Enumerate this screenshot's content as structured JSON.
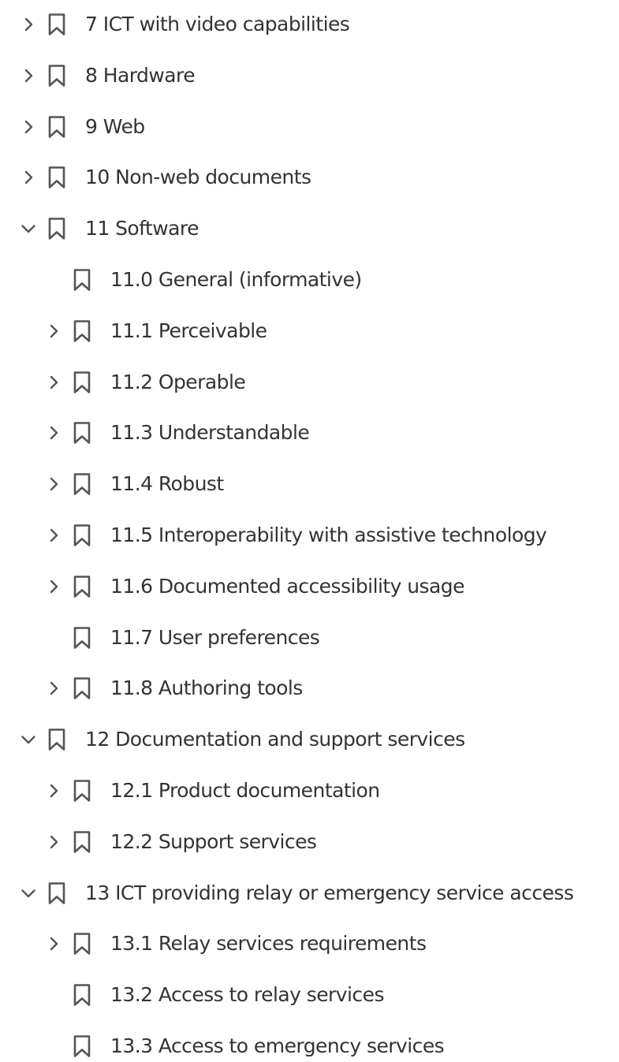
{
  "bookmarks": {
    "items": [
      {
        "label": "7 ICT with video capabilities",
        "level": 0,
        "toggle": "collapsed"
      },
      {
        "label": "8 Hardware",
        "level": 0,
        "toggle": "collapsed"
      },
      {
        "label": "9 Web",
        "level": 0,
        "toggle": "collapsed"
      },
      {
        "label": "10 Non-web documents",
        "level": 0,
        "toggle": "collapsed"
      },
      {
        "label": "11 Software",
        "level": 0,
        "toggle": "expanded"
      },
      {
        "label": "11.0 General (informative)",
        "level": 1,
        "toggle": "none"
      },
      {
        "label": "11.1 Perceivable",
        "level": 1,
        "toggle": "collapsed"
      },
      {
        "label": "11.2 Operable",
        "level": 1,
        "toggle": "collapsed"
      },
      {
        "label": "11.3 Understandable",
        "level": 1,
        "toggle": "collapsed"
      },
      {
        "label": "11.4 Robust",
        "level": 1,
        "toggle": "collapsed"
      },
      {
        "label": "11.5 Interoperability with assistive technology",
        "level": 1,
        "toggle": "collapsed"
      },
      {
        "label": "11.6 Documented accessibility usage",
        "level": 1,
        "toggle": "collapsed"
      },
      {
        "label": "11.7 User preferences",
        "level": 1,
        "toggle": "none"
      },
      {
        "label": "11.8 Authoring tools",
        "level": 1,
        "toggle": "collapsed"
      },
      {
        "label": "12 Documentation and support services",
        "level": 0,
        "toggle": "expanded"
      },
      {
        "label": "12.1 Product documentation",
        "level": 1,
        "toggle": "collapsed"
      },
      {
        "label": "12.2 Support services",
        "level": 1,
        "toggle": "collapsed"
      },
      {
        "label": "13 ICT providing relay or emergency service access",
        "level": 0,
        "toggle": "expanded"
      },
      {
        "label": "13.1 Relay services requirements",
        "level": 1,
        "toggle": "collapsed"
      },
      {
        "label": "13.2 Access to relay services",
        "level": 1,
        "toggle": "none"
      },
      {
        "label": "13.3 Access to emergency services",
        "level": 1,
        "toggle": "none"
      }
    ]
  },
  "icons": {
    "expand": "chevron-right-icon",
    "collapse": "chevron-down-icon",
    "bookmark": "bookmark-icon"
  },
  "colors": {
    "text": "#333333",
    "icon": "#555555",
    "background": "#ffffff"
  }
}
